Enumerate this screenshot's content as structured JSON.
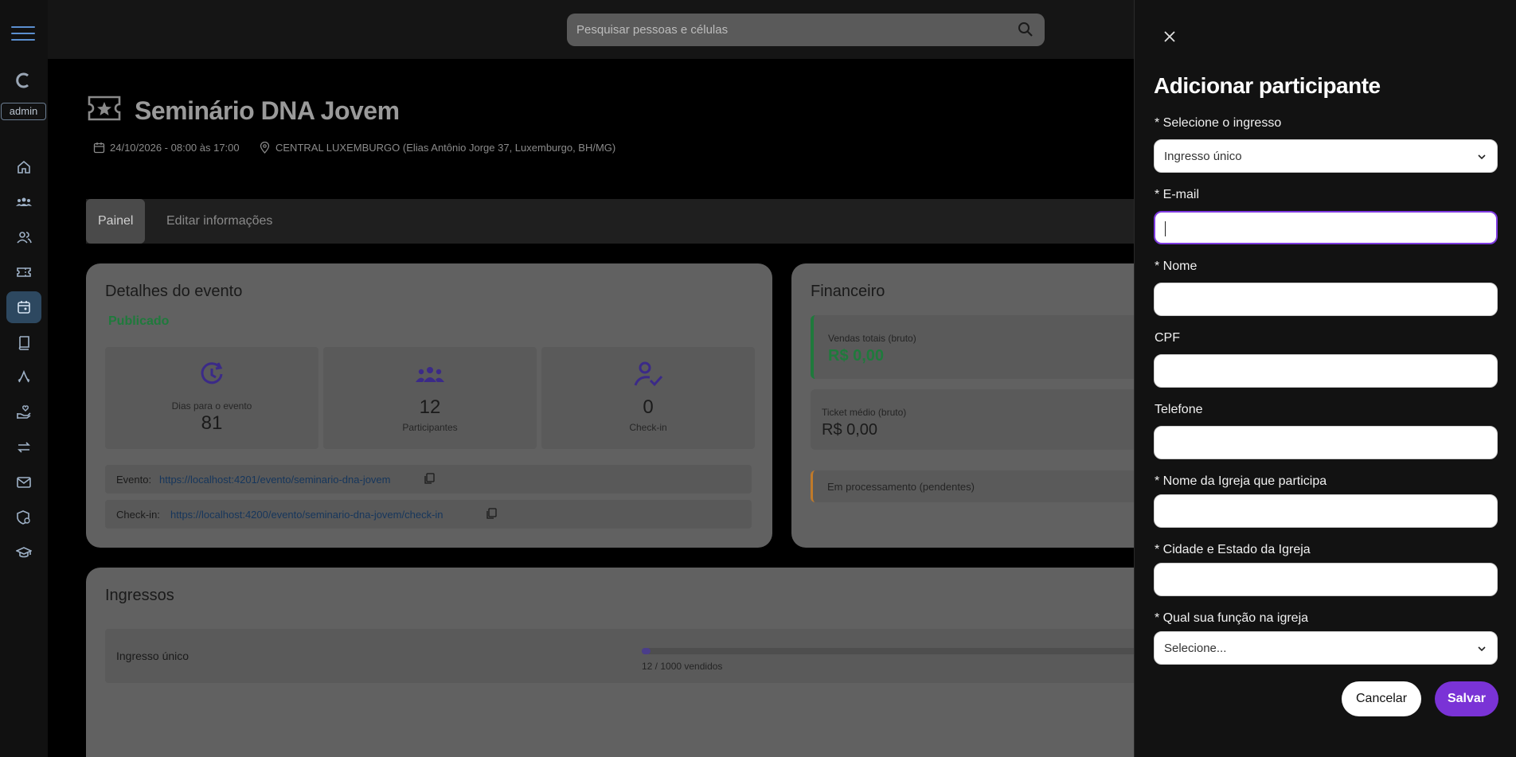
{
  "sidebar": {
    "admin_label": "admin",
    "items": [
      {
        "icon": "home-icon"
      },
      {
        "icon": "groups-icon"
      },
      {
        "icon": "people-icon"
      },
      {
        "icon": "ticket-icon"
      },
      {
        "icon": "calendar-icon",
        "active": true
      },
      {
        "icon": "book-icon"
      },
      {
        "icon": "praying-hands-icon"
      },
      {
        "icon": "hand-heart-icon"
      },
      {
        "icon": "arrows-exchange-icon"
      },
      {
        "icon": "mail-icon"
      },
      {
        "icon": "shield-settings-icon"
      },
      {
        "icon": "graduation-cap-icon"
      }
    ]
  },
  "search": {
    "placeholder": "Pesquisar pessoas e células"
  },
  "event": {
    "title": "Seminário DNA Jovem",
    "date": "24/10/2026 - 08:00 às 17:00",
    "location": "CENTRAL LUXEMBURGO (Elias Antônio Jorge 37, Luxemburgo, BH/MG)"
  },
  "tabs": [
    {
      "label": "Painel",
      "active": true
    },
    {
      "label": "Editar informações",
      "active": false
    }
  ],
  "details": {
    "title": "Detalhes do evento",
    "status": "Publicado",
    "stats": [
      {
        "icon": "clock-icon",
        "label": "Dias para o evento",
        "value": "81"
      },
      {
        "icon": "participants-icon",
        "label": "Participantes",
        "value": "12"
      },
      {
        "icon": "user-check-icon",
        "label": "Check-in",
        "value": "0"
      }
    ],
    "event_link_label": "Evento:",
    "event_link": "https://localhost:4201/evento/seminario-dna-jovem",
    "checkin_link_label": "Check-in:",
    "checkin_link": "https://localhost:4200/evento/seminario-dna-jovem/check-in"
  },
  "financial": {
    "title": "Financeiro",
    "total_sales_label": "Vendas totais (bruto)",
    "total_sales_value": "R$ 0,00",
    "avg_ticket_label": "Ticket médio (bruto)",
    "avg_ticket_value": "R$ 0,00",
    "processing_label": "Em processamento (pendentes)"
  },
  "tickets": {
    "title": "Ingressos",
    "items": [
      {
        "name": "Ingresso único",
        "sold_text": "12 / 1000 vendidos",
        "sold_fraction": 0.012
      }
    ]
  },
  "colors": {
    "accent": "#7a33d6",
    "success": "#1f7a3c",
    "warning": "#c07a2a",
    "sidebar_active": "#2d4860"
  },
  "drawer": {
    "title": "Adicionar participante",
    "fields": [
      {
        "label": "* Selecione o ingresso",
        "type": "select",
        "value": "Ingresso único"
      },
      {
        "label": "* E-mail",
        "type": "input",
        "value": "",
        "focused": true
      },
      {
        "label": "* Nome",
        "type": "input",
        "value": ""
      },
      {
        "label": "CPF",
        "type": "input",
        "value": ""
      },
      {
        "label": "Telefone",
        "type": "input",
        "value": ""
      },
      {
        "label": "* Nome da Igreja que participa",
        "type": "input",
        "value": ""
      },
      {
        "label": "* Cidade e Estado da Igreja",
        "type": "input",
        "value": ""
      },
      {
        "label": "* Qual sua função na igreja",
        "type": "select",
        "value": "Selecione..."
      }
    ],
    "cancel_label": "Cancelar",
    "save_label": "Salvar"
  }
}
